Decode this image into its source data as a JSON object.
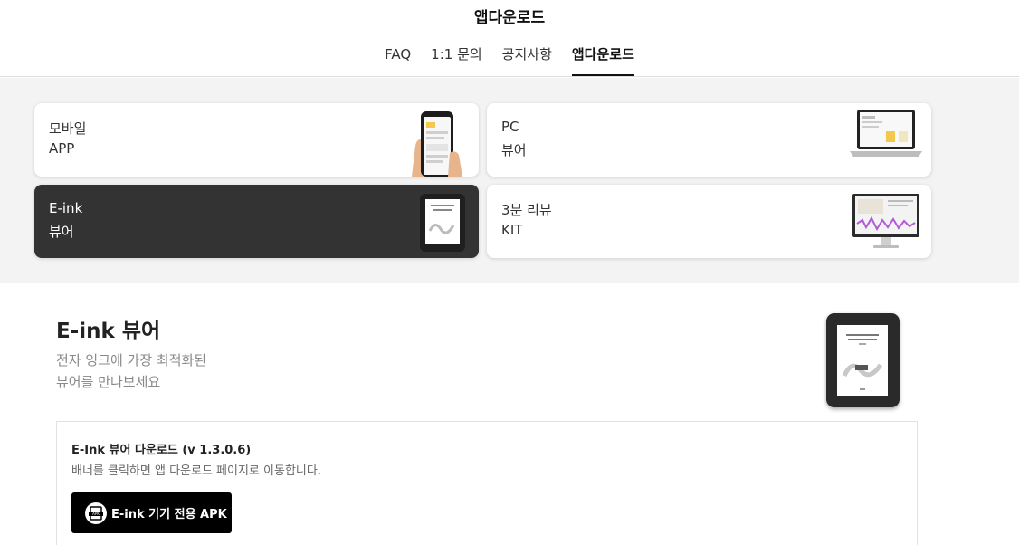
{
  "header": {
    "title": "앱다운로드",
    "tabs": [
      {
        "label": "FAQ",
        "active": false
      },
      {
        "label": "1:1 문의",
        "active": false
      },
      {
        "label": "공지사항",
        "active": false
      },
      {
        "label": "앱다운로드",
        "active": true
      }
    ]
  },
  "cards": [
    {
      "line1": "모바일",
      "line2": "APP",
      "selected": false,
      "thumb": "smartphone-in-hand"
    },
    {
      "line1": "PC",
      "line2": "뷰어",
      "selected": false,
      "thumb": "laptop"
    },
    {
      "line1": "E-ink",
      "line2": "뷰어",
      "selected": true,
      "thumb": "e-reader"
    },
    {
      "line1": "3분 리뷰",
      "line2": "KIT",
      "selected": false,
      "thumb": "desktop-monitor"
    }
  ],
  "section": {
    "title": "E-ink 뷰어",
    "desc_line1": "전자 잉크에 가장 최적화된",
    "desc_line2": "뷰어를 만나보세요"
  },
  "download": {
    "title": "E-Ink 뷰어 다운로드 (v 1.3.0.6)",
    "desc": "배너를 클릭하면 앱 다운로드 페이지로 이동합니다.",
    "button_label": "E-ink 기기 전용 APK",
    "button_icon": "apk-icon"
  },
  "colors": {
    "selected_card": "#333333",
    "card_area_bg": "#f3f3f3",
    "apk_button": "#000000"
  }
}
